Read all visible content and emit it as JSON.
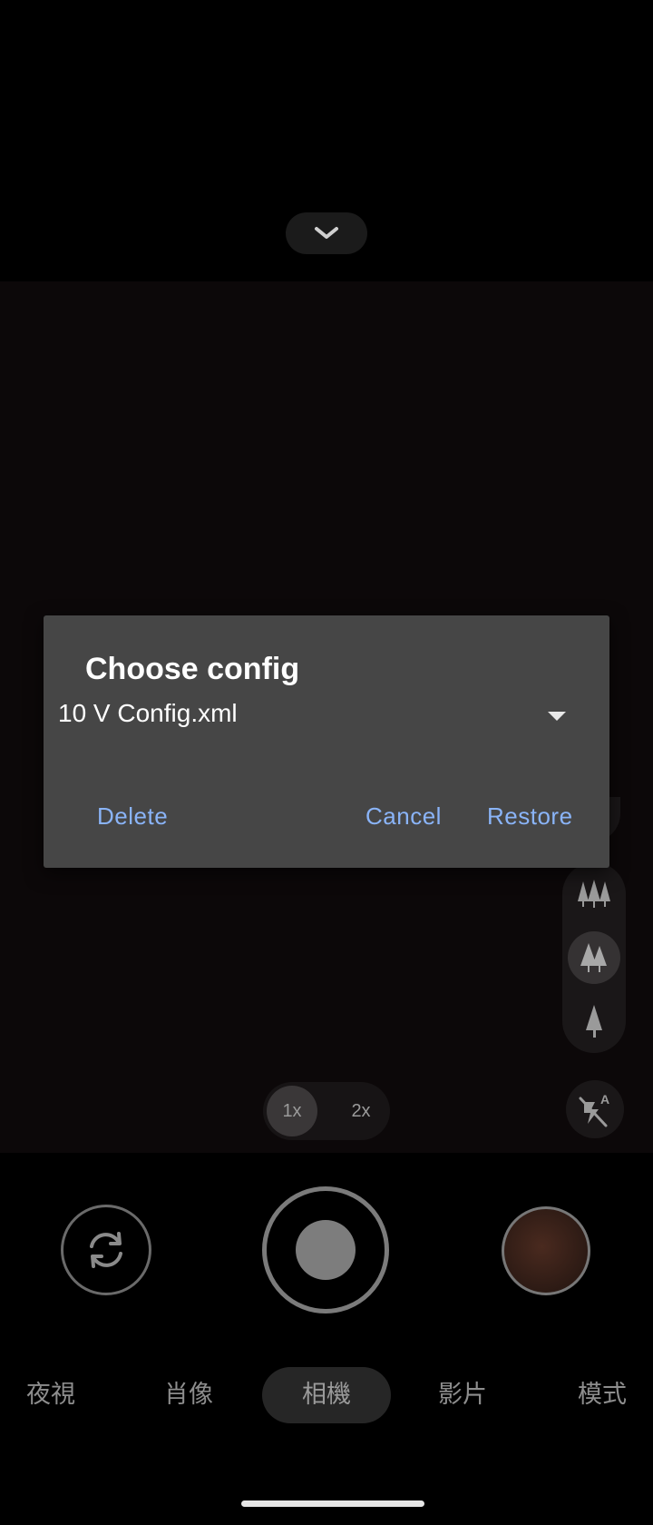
{
  "dialog": {
    "title": "Choose config",
    "selected_config": "10 V Config.xml",
    "delete_label": "Delete",
    "cancel_label": "Cancel",
    "restore_label": "Restore"
  },
  "zoom": {
    "options": [
      "1x",
      "2x"
    ],
    "selected": "1x"
  },
  "modes": {
    "items": [
      "夜視",
      "肖像",
      "相機",
      "影片",
      "模式"
    ],
    "selected": "相機"
  },
  "icons": {
    "top_handle": "chevron-down-icon",
    "switch_camera": "switch-camera-icon",
    "flash": "flash-auto-off-icon",
    "depth": [
      "trees-many-icon",
      "trees-two-icon",
      "tree-single-icon"
    ]
  },
  "colors": {
    "dialog_bg": "#464646",
    "dialog_button": "#8ab4f8"
  }
}
